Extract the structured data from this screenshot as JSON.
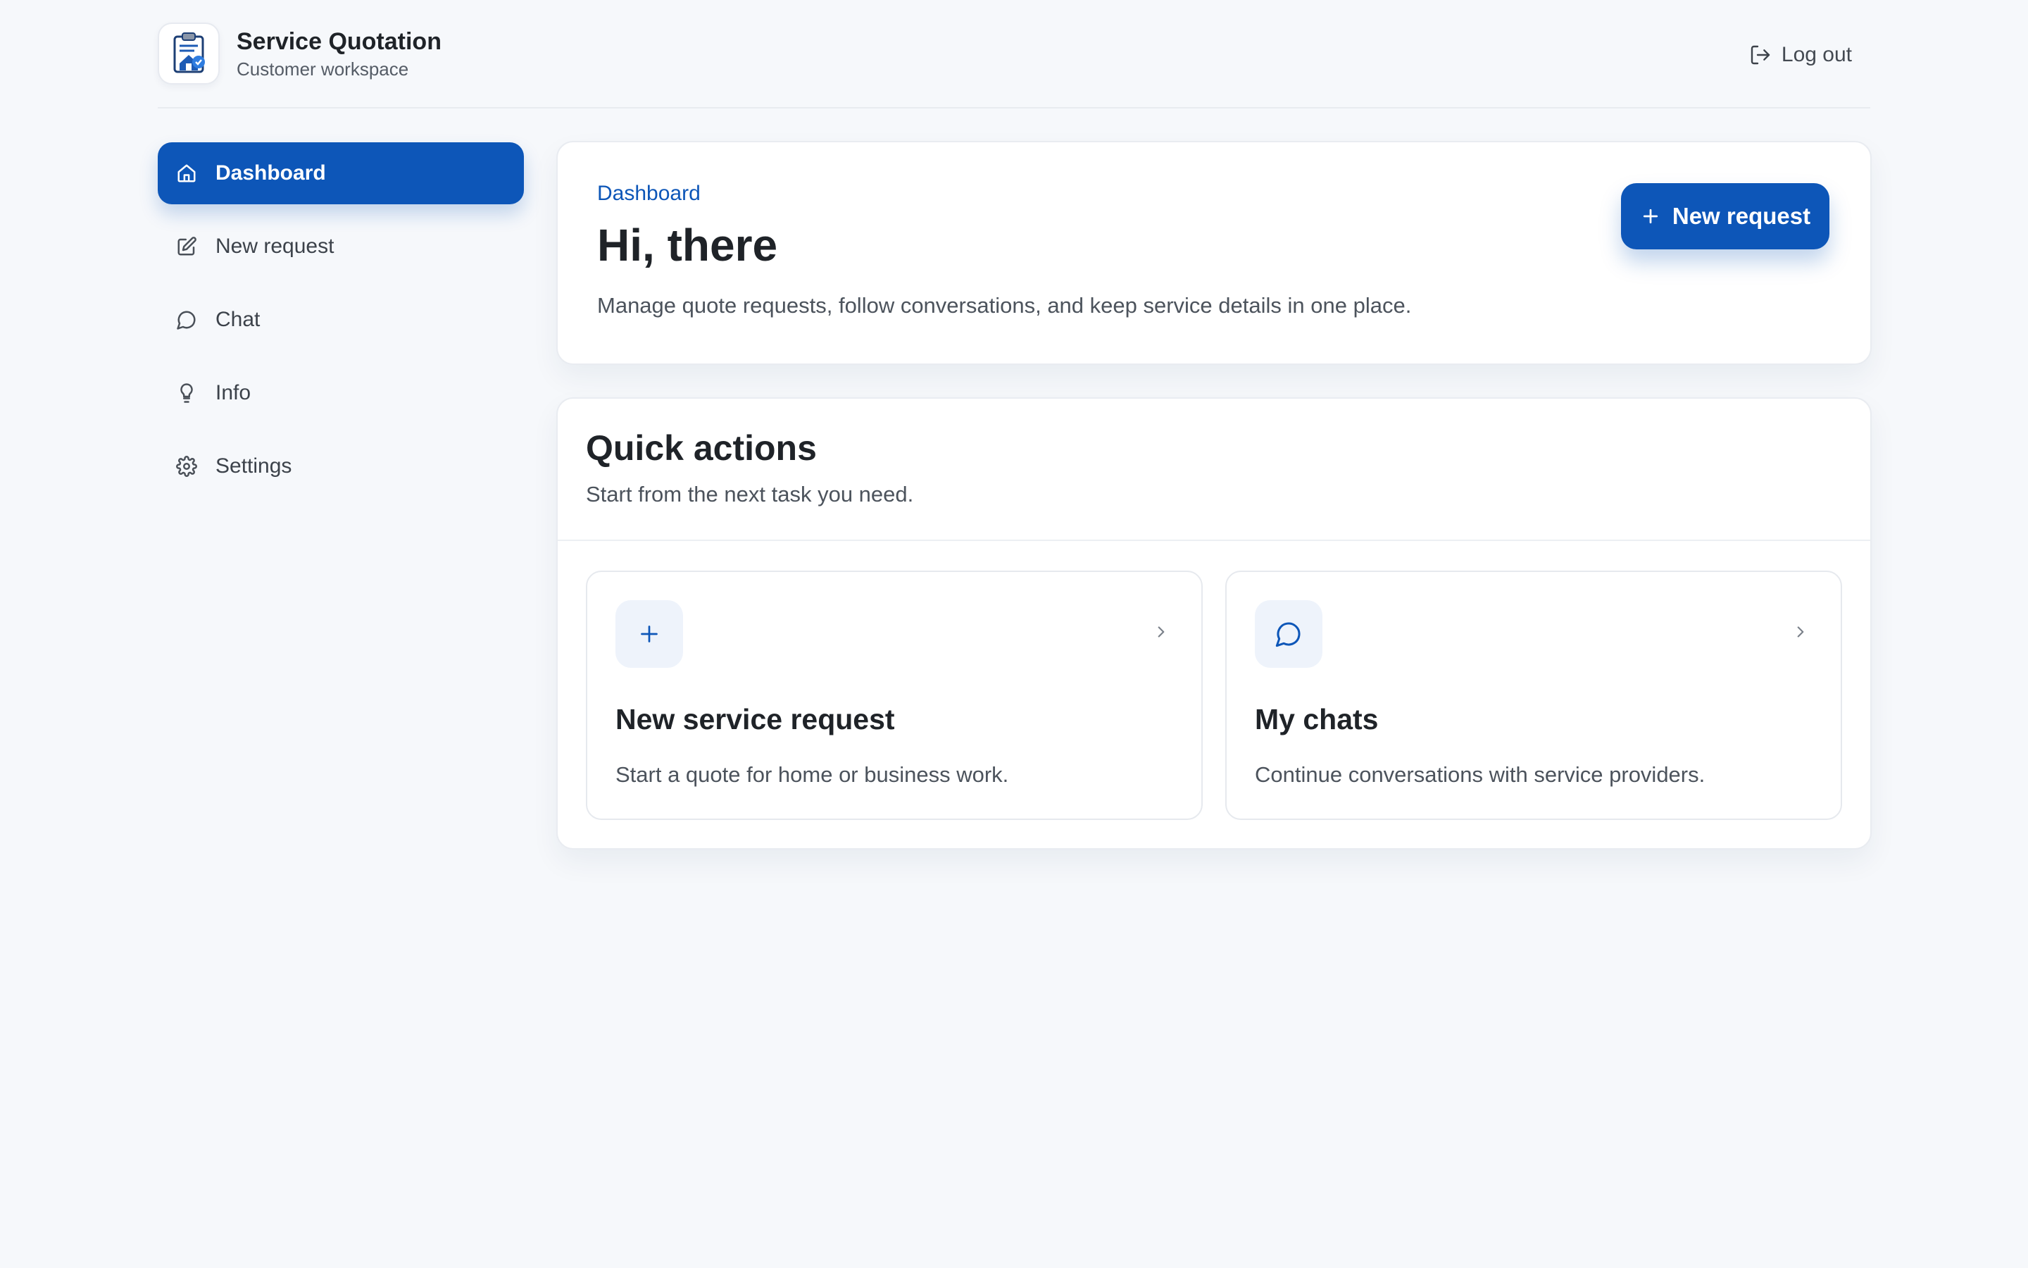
{
  "header": {
    "logo_icon": "clipboard-house-logo-icon",
    "app_title": "Service Quotation",
    "app_subtitle": "Customer workspace",
    "logout": {
      "label": "Log out",
      "icon": "logout-icon"
    }
  },
  "sidebar": {
    "items": [
      {
        "label": "Dashboard",
        "icon": "home-icon",
        "active": true
      },
      {
        "label": "New request",
        "icon": "edit-icon",
        "active": false
      },
      {
        "label": "Chat",
        "icon": "chat-bubble-icon",
        "active": false
      },
      {
        "label": "Info",
        "icon": "lightbulb-icon",
        "active": false
      },
      {
        "label": "Settings",
        "icon": "gear-icon",
        "active": false
      }
    ]
  },
  "hero": {
    "eyebrow": "Dashboard",
    "title": "Hi, there",
    "description": "Manage quote requests, follow conversations, and keep service details in one place.",
    "button_label": "New request",
    "button_icon": "plus-icon"
  },
  "quick_actions": {
    "title": "Quick actions",
    "subtitle": "Start from the next task you need.",
    "cards": [
      {
        "title": "New service request",
        "description": "Start a quote for home or business work.",
        "icon": "plus-icon"
      },
      {
        "title": "My chats",
        "description": "Continue conversations with service providers.",
        "icon": "chat-bubble-icon"
      }
    ]
  },
  "colors": {
    "accent": "#0d56b8",
    "background": "#f6f8fb",
    "card": "#ffffff",
    "text": "#1f2328",
    "muted_text": "#4c535c",
    "icon_tile": "#eef3fb"
  }
}
